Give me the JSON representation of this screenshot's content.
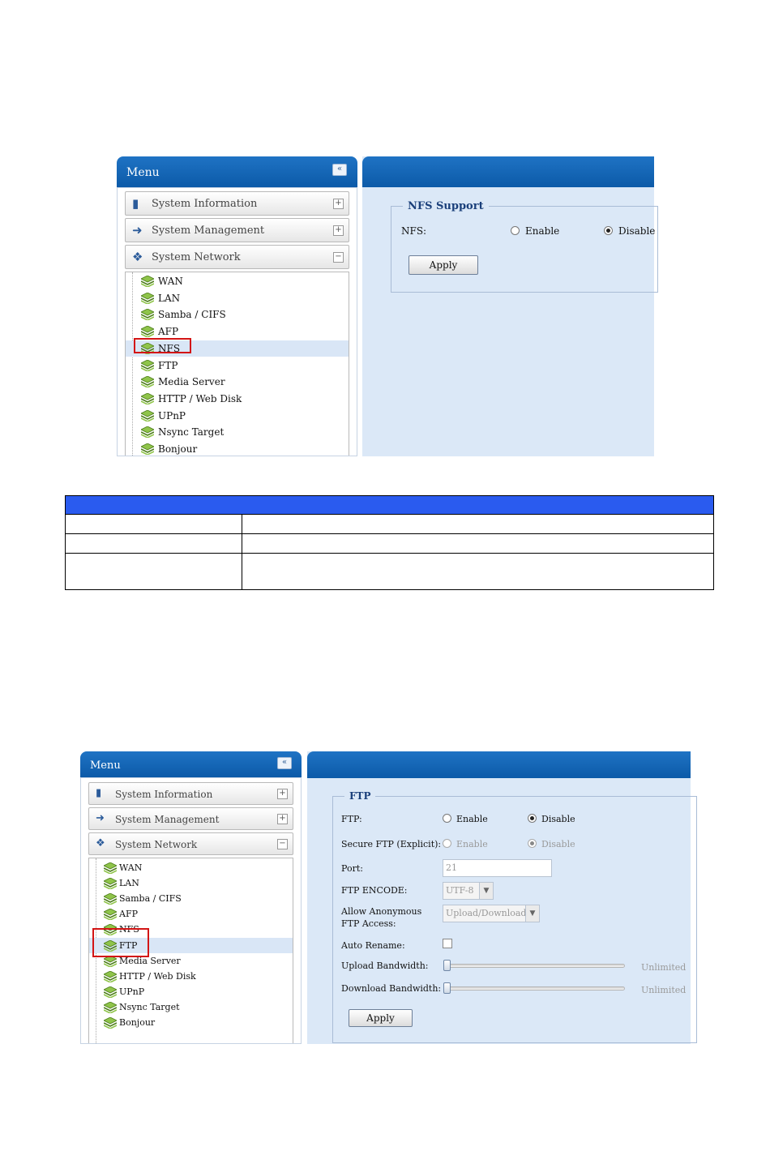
{
  "screens": [
    {
      "menu": {
        "title": "Menu",
        "collapse_icon": "«",
        "categories": [
          {
            "label": "System Information",
            "icon": "info-book-icon",
            "toggle": "+"
          },
          {
            "label": "System Management",
            "icon": "wrench-icon",
            "toggle": "+"
          },
          {
            "label": "System Network",
            "icon": "network-icon",
            "toggle": "−"
          }
        ],
        "items": [
          "WAN",
          "LAN",
          "Samba / CIFS",
          "AFP",
          "NFS",
          "FTP",
          "Media Server",
          "HTTP / Web Disk",
          "UPnP",
          "Nsync Target",
          "Bonjour"
        ],
        "selected": "NFS"
      },
      "content": {
        "legend": "NFS Support",
        "nfs_label": "NFS:",
        "enable_label": "Enable",
        "disable_label": "Disable",
        "selected_option": "Disable",
        "apply_label": "Apply"
      }
    },
    {
      "menu": {
        "title": "Menu",
        "collapse_icon": "«",
        "categories": [
          {
            "label": "System Information",
            "icon": "info-book-icon",
            "toggle": "+"
          },
          {
            "label": "System Management",
            "icon": "wrench-icon",
            "toggle": "+"
          },
          {
            "label": "System Network",
            "icon": "network-icon",
            "toggle": "−"
          }
        ],
        "items": [
          "WAN",
          "LAN",
          "Samba / CIFS",
          "AFP",
          "NFS",
          "FTP",
          "Media Server",
          "HTTP / Web Disk",
          "UPnP",
          "Nsync Target",
          "Bonjour"
        ],
        "selected": "FTP"
      },
      "content": {
        "legend": "FTP",
        "ftp_label": "FTP:",
        "ftp_enable": "Enable",
        "ftp_disable": "Disable",
        "ftp_selected": "Disable",
        "secure_label": "Secure FTP (Explicit):",
        "secure_enable": "Enable",
        "secure_disable": "Disable",
        "secure_selected": "Disable",
        "port_label": "Port:",
        "port_value": "21",
        "encode_label": "FTP ENCODE:",
        "encode_value": "UTF-8",
        "anon_label_1": "Allow Anonymous",
        "anon_label_2": "FTP Access:",
        "anon_value": "Upload/Download",
        "rename_label": "Auto Rename:",
        "rename_checked": false,
        "upload_label": "Upload Bandwidth:",
        "upload_value": "Unlimited",
        "download_label": "Download Bandwidth:",
        "download_value": "Unlimited",
        "apply_label": "Apply"
      }
    }
  ],
  "colors": {
    "header_blue": "#0c5aa8",
    "content_bg": "#dbe8f7",
    "highlight_red": "#d31515",
    "table_header": "#2a5bef"
  }
}
